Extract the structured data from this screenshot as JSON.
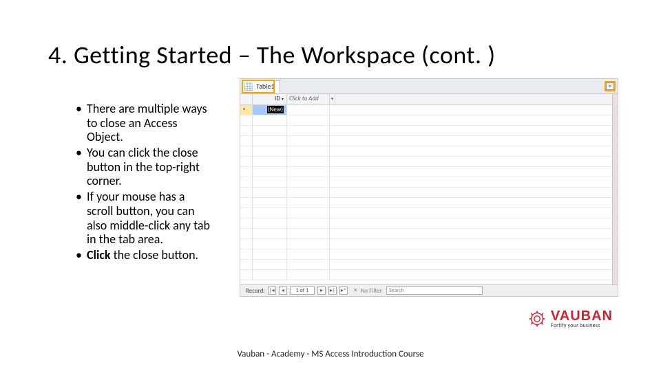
{
  "title": "4. Getting Started – The Workspace (cont. )",
  "bullets": [
    "There are multiple ways to close an Access Object.",
    "You can click the close button in the top-right corner.",
    "If your mouse has a scroll button, you can also middle-click any tab in the tab area.",
    "<strong>Click</strong> the close button."
  ],
  "screenshot": {
    "tab_label": "Table1",
    "close_x": "×",
    "col_id": "ID",
    "col_click_to_add": "Click to Add",
    "row_new_label": "(New)",
    "nav": {
      "record_label": "Record:",
      "first": "|◂",
      "prev": "◂",
      "pos": "1 of 1",
      "next": "▸",
      "last": "▸|",
      "new": "▸*",
      "no_filter": "No Filter",
      "search_placeholder": "Search"
    }
  },
  "brand": {
    "name": "VAUBAN",
    "tagline": "Fortify your business",
    "gear_color": "#d21f2d"
  },
  "footer": "Vauban - Academy - MS Access Introduction Course"
}
